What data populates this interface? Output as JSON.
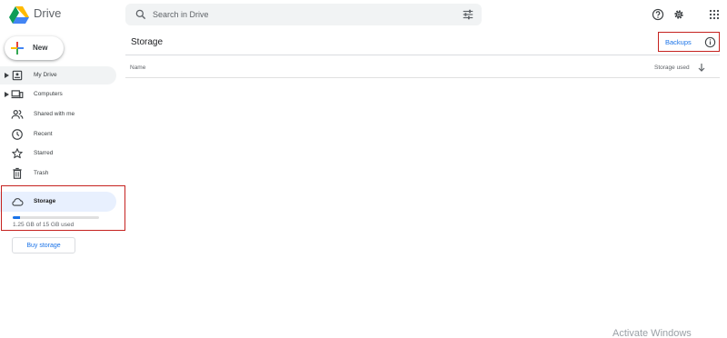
{
  "app": {
    "title": "Drive"
  },
  "search": {
    "placeholder": "Search in Drive"
  },
  "icons": {
    "search": "search-icon",
    "tune": "tune-icon",
    "help": "help-icon",
    "settings": "gear-icon",
    "apps": "apps-grid-icon",
    "info": "info-icon"
  },
  "sidebar": {
    "new_label": "New",
    "items": [
      {
        "label": "My Drive",
        "icon": "my-drive-icon",
        "expandable": true
      },
      {
        "label": "Computers",
        "icon": "computers-icon",
        "expandable": true
      },
      {
        "label": "Shared with me",
        "icon": "shared-icon",
        "expandable": false
      },
      {
        "label": "Recent",
        "icon": "clock-icon",
        "expandable": false
      },
      {
        "label": "Starred",
        "icon": "star-icon",
        "expandable": false
      },
      {
        "label": "Trash",
        "icon": "trash-icon",
        "expandable": false
      },
      {
        "label": "Storage",
        "icon": "cloud-icon",
        "expandable": false,
        "selected": true
      }
    ],
    "storage": {
      "used_text": "1.25 GB of 15 GB used",
      "used_fraction": 0.083
    },
    "buy_label": "Buy storage"
  },
  "main": {
    "title": "Storage",
    "backups_label": "Backups",
    "columns": {
      "name": "Name",
      "storage_used": "Storage used"
    }
  },
  "watermark": "Activate Windows",
  "colors": {
    "accent": "#1a73e8",
    "highlight": "#c5221f",
    "selected_bg": "#e8f0fe"
  }
}
